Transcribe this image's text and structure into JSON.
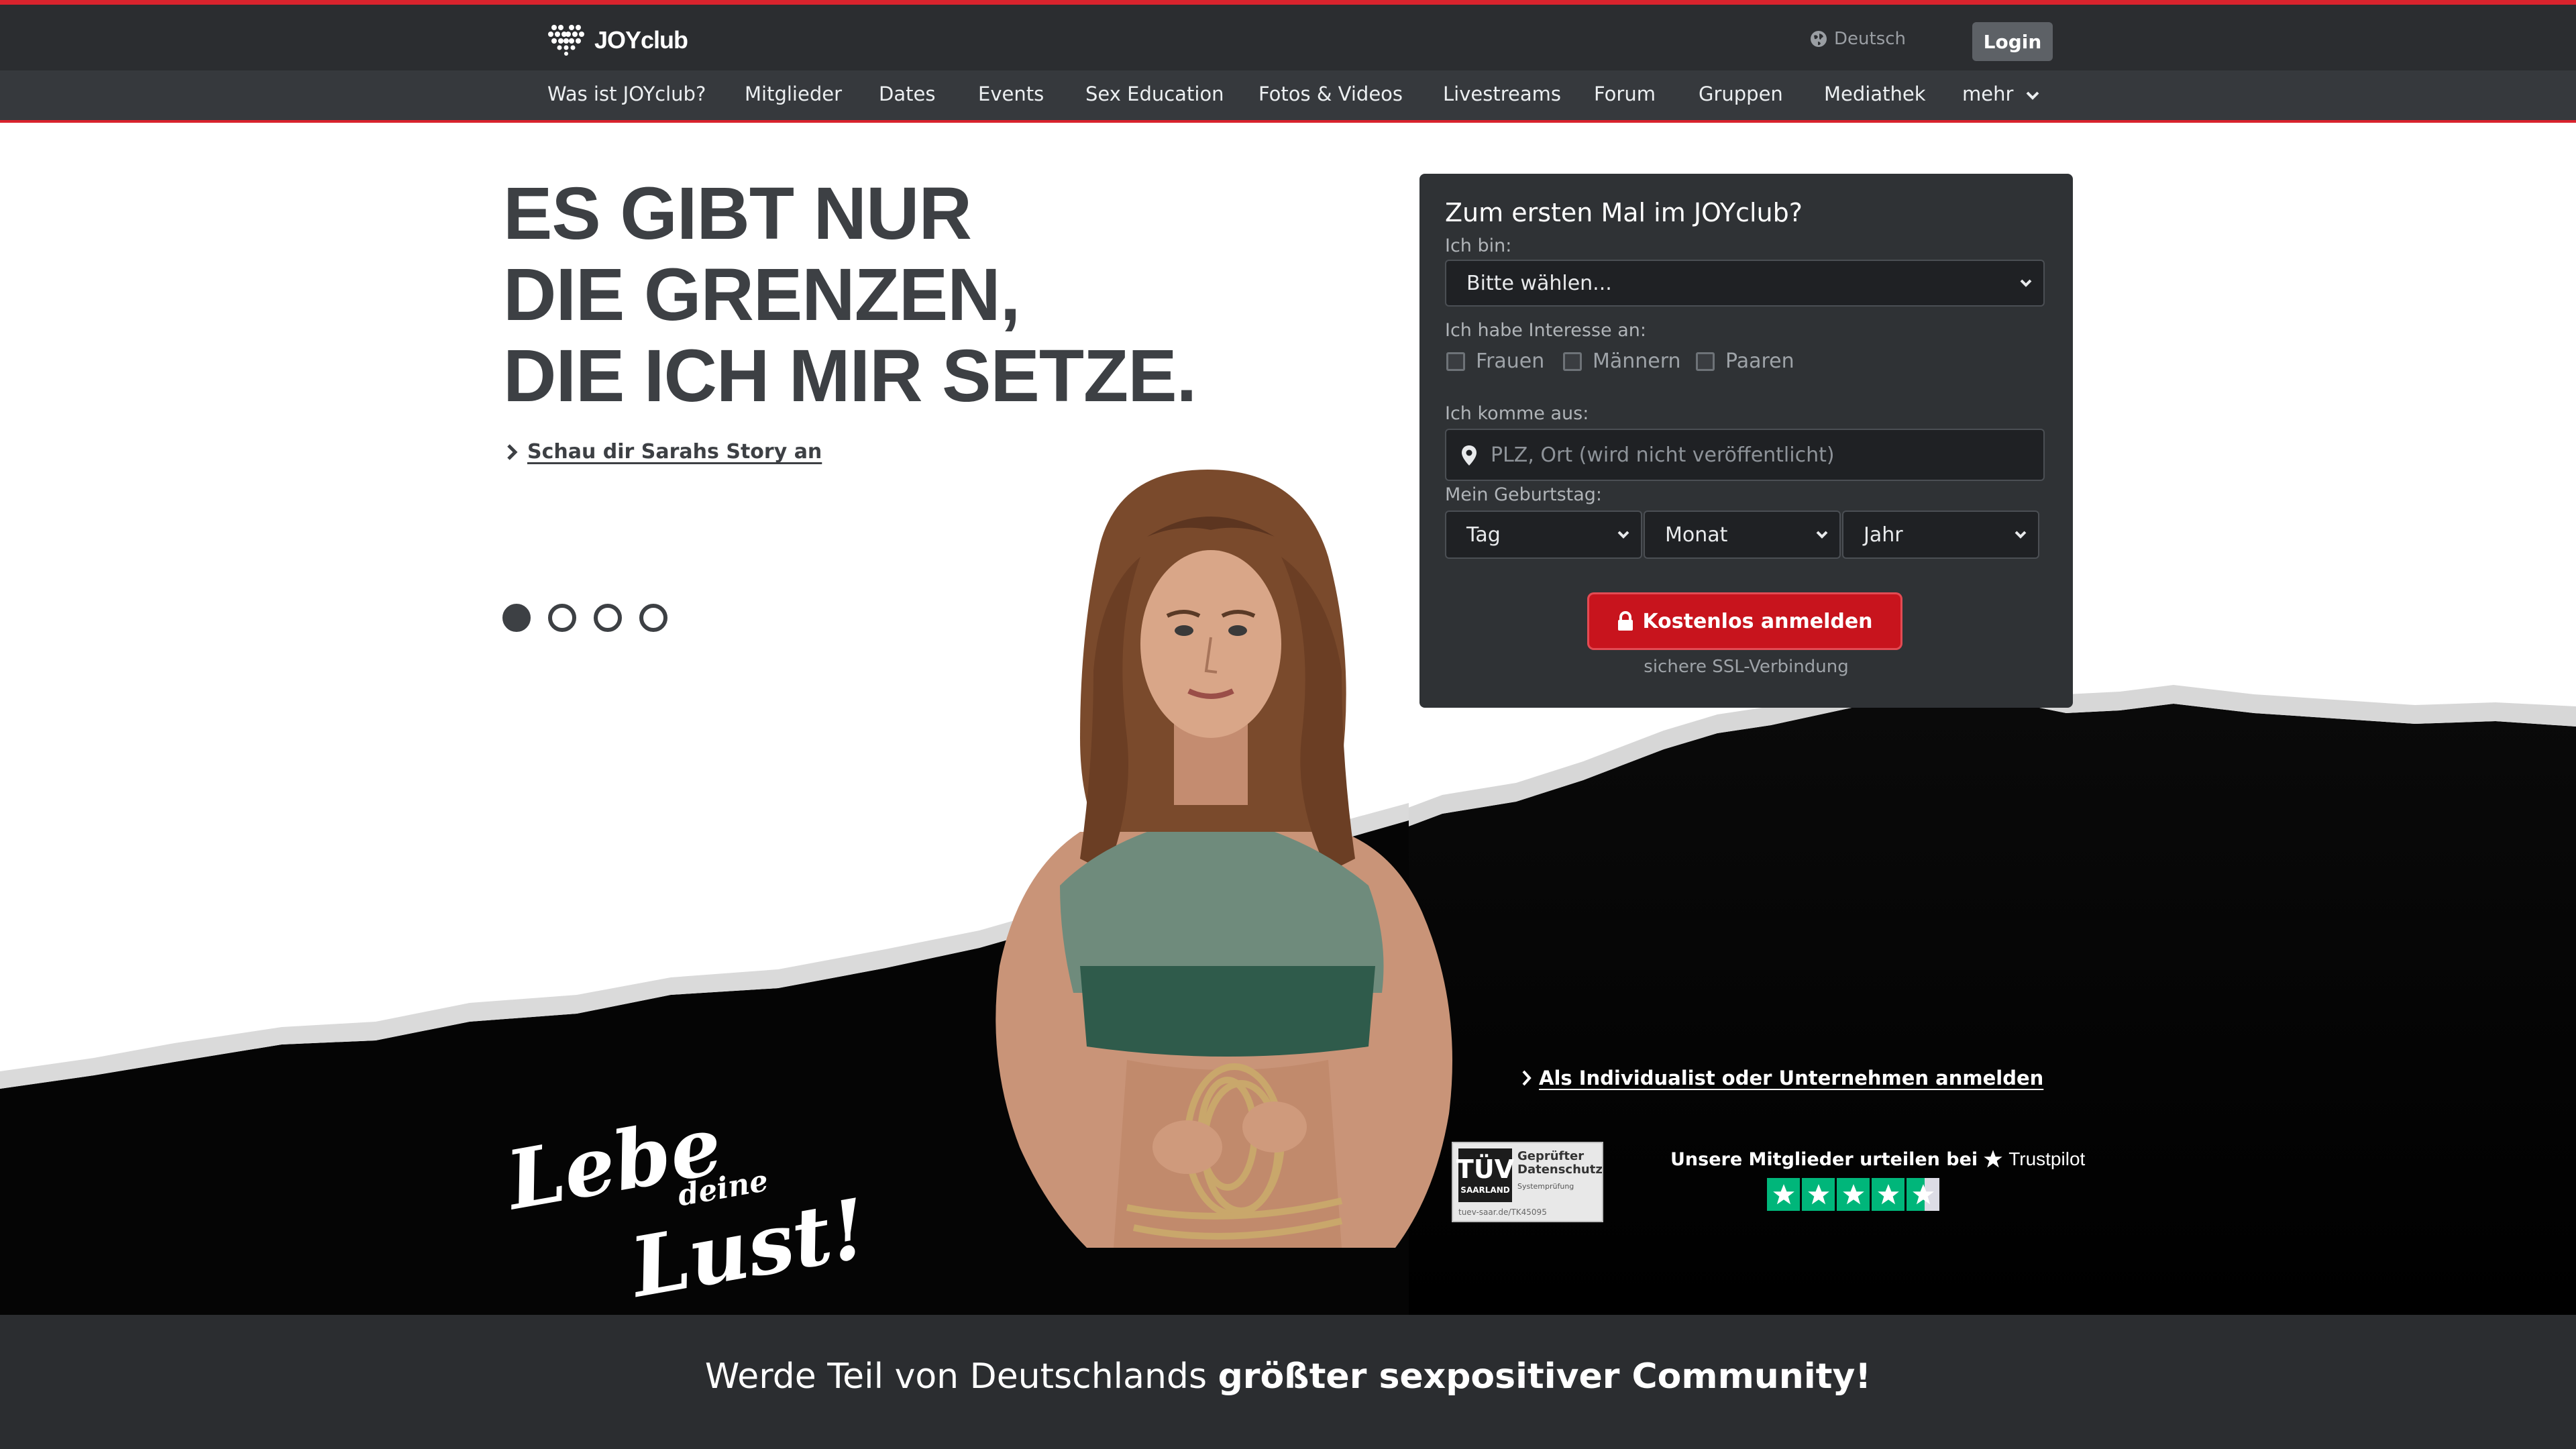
{
  "header": {
    "logo_text": "JOYclub",
    "language": "Deutsch",
    "login_label": "Login"
  },
  "nav": {
    "items": [
      "Was ist JOYclub?",
      "Mitglieder",
      "Dates",
      "Events",
      "Sex Education",
      "Fotos & Videos",
      "Livestreams",
      "Forum",
      "Gruppen",
      "Mediathek",
      "mehr"
    ]
  },
  "hero": {
    "headline": [
      "ES GIBT NUR",
      "DIE GRENZEN,",
      "DIE ICH MIR SETZE."
    ],
    "story_link": "Schau dir Sarahs Story an",
    "slides": 4,
    "active_slide": 1
  },
  "register": {
    "title": "Zum ersten Mal im JOYclub?",
    "iam_label": "Ich bin:",
    "iam_value": "Bitte wählen...",
    "interest_label": "Ich habe Interesse an:",
    "interests": [
      "Frauen",
      "Männern",
      "Paaren"
    ],
    "from_label": "Ich komme aus:",
    "location_placeholder": "PLZ, Ort (wird nicht veröffentlicht)",
    "birthday_label": "Mein Geburtstag:",
    "day": "Tag",
    "month": "Monat",
    "year": "Jahr",
    "submit": "Kostenlos anmelden",
    "ssl": "sichere SSL-Verbindung"
  },
  "lower": {
    "business_link": "Als Individualist oder Unternehmen anmelden",
    "slogan_1": "Lebe",
    "slogan_2": "deine",
    "slogan_3": "Lust!",
    "tuv_mark": "TÜV",
    "tuv_region": "SAARLAND",
    "tuv_title": "Geprüfter Datenschutz",
    "tuv_sub": "Systemprüfung",
    "tuv_url": "tuev-saar.de/TK45095",
    "trustpilot_text": "Unsere Mitglieder urteilen bei",
    "trustpilot_brand": "Trustpilot",
    "rating_stars": 4.5
  },
  "band": {
    "text_regular": "Werde Teil von Deutschlands",
    "text_bold": "größter sexpositiver Community!"
  },
  "colors": {
    "accent": "#d9232d",
    "dark": "#2b2d30",
    "panel": "#2f3235",
    "trustpilot_green": "#00b67a"
  }
}
